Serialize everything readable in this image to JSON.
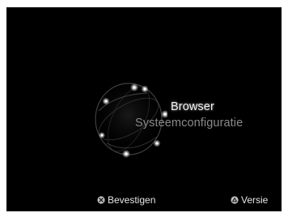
{
  "menu": {
    "items": [
      {
        "label": "Browser",
        "selected": true
      },
      {
        "label": "Systeemconfiguratie",
        "selected": false
      }
    ]
  },
  "footer": {
    "confirm": {
      "icon": "cross-button-icon",
      "label": "Bevestigen"
    },
    "version": {
      "icon": "triangle-button-icon",
      "label": "Versie"
    }
  },
  "colors": {
    "background": "#000000",
    "selected_text": "#f2f2f2",
    "unselected_text": "#8a8a8a",
    "footer_text": "#e6e6e6"
  }
}
